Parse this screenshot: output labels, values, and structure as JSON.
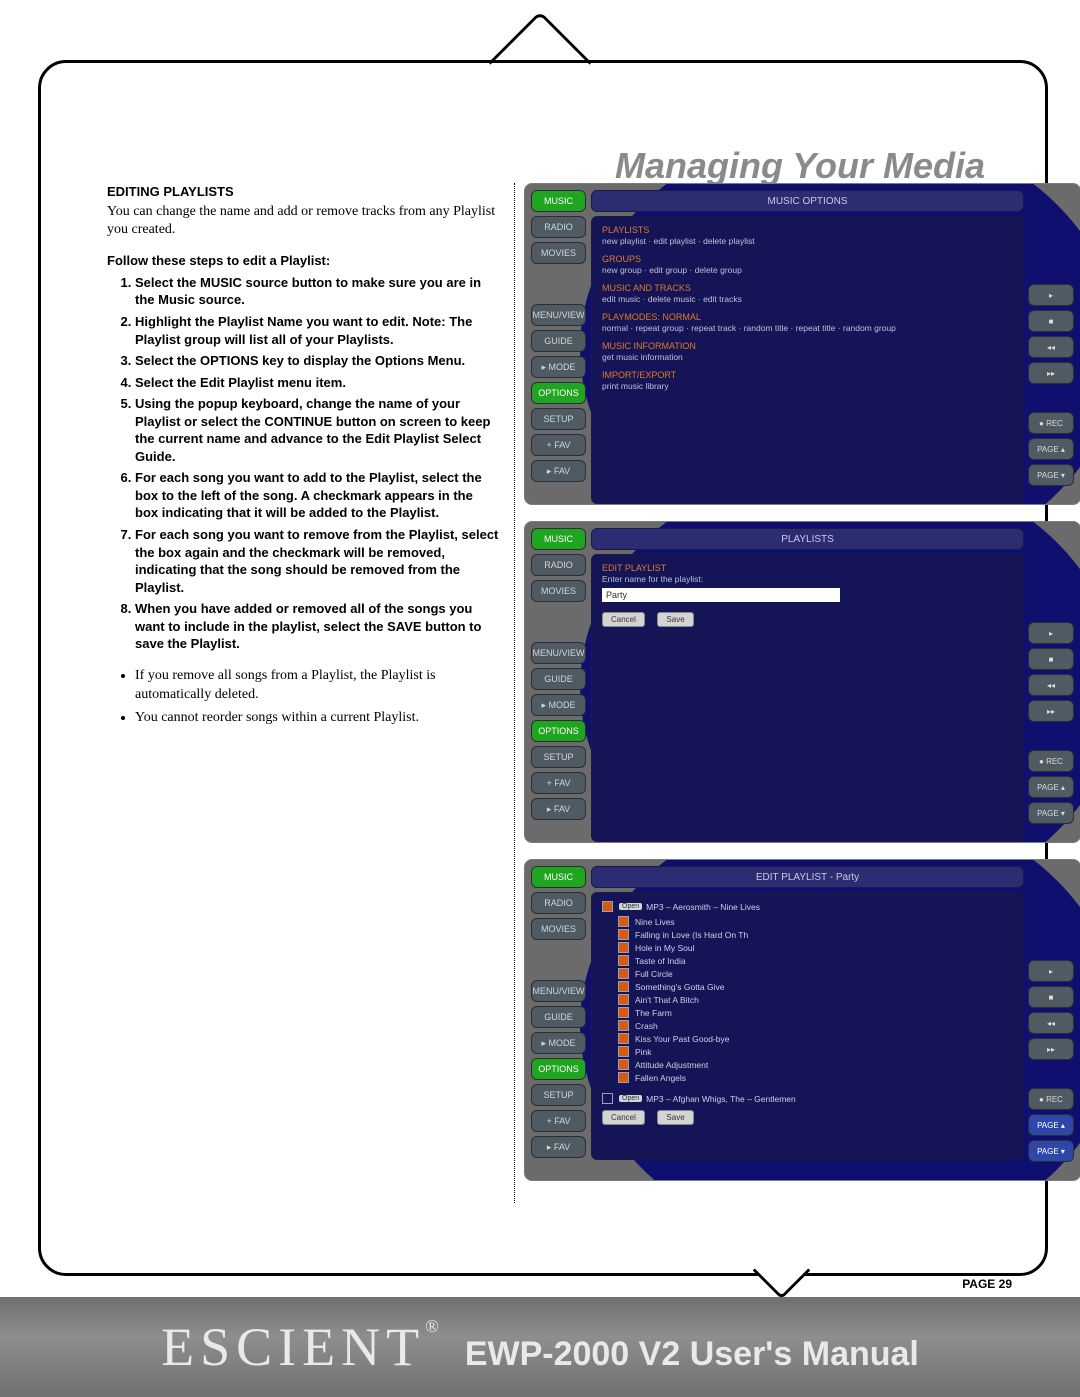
{
  "header": "Managing Your Media",
  "section_title": "EDITING PLAYLISTS",
  "intro": "You can change the name and add or remove tracks from any Playlist you created.",
  "steps_title": "Follow these steps to edit a Playlist:",
  "steps": [
    "Select the MUSIC source button to make sure you are in the Music source.",
    "Highlight the Playlist Name you want to edit. Note: The Playlist group will list all of your Playlists.",
    "Select the OPTIONS key to display the Options Menu.",
    "Select the Edit Playlist menu item.",
    "Using the popup keyboard, change the name of your Playlist or select the CONTINUE button on screen to keep the current name and advance to the Edit Playlist Select Guide.",
    "For each song you want to add to the Playlist, select the box to the left of the song. A checkmark appears in the box indicating that it will be added to the Playlist.",
    "For each song you want to remove from the Playlist, select the box again and the checkmark will be removed, indicating that the song should be removed from the Playlist.",
    "When you have added or removed all of the songs you want to include in the playlist, select the SAVE button to save the Playlist."
  ],
  "notes": [
    "If you remove all songs from a Playlist, the Playlist is automatically deleted.",
    "You cannot reorder songs within a current Playlist."
  ],
  "side_buttons": [
    "MUSIC",
    "RADIO",
    "MOVIES",
    "",
    "MENU/VIEW",
    "GUIDE",
    "▸ MODE",
    "OPTIONS",
    "SETUP",
    "+ FAV",
    "▸ FAV"
  ],
  "right_buttons": [
    "▸",
    "■",
    "◂◂",
    "▸▸",
    "● REC",
    "PAGE ▴",
    "PAGE ▾"
  ],
  "shot1": {
    "title": "MUSIC OPTIONS",
    "options": [
      {
        "head": "PLAYLISTS",
        "sub": "new playlist · edit playlist · delete playlist"
      },
      {
        "head": "GROUPS",
        "sub": "new group · edit group · delete group"
      },
      {
        "head": "MUSIC AND TRACKS",
        "sub": "edit music · delete music · edit tracks"
      },
      {
        "head": "PLAYMODES: NORMAL",
        "sub": "normal · repeat group · repeat track · random title · repeat title · random group"
      },
      {
        "head": "MUSIC INFORMATION",
        "sub": "get music information"
      },
      {
        "head": "IMPORT/EXPORT",
        "sub": "print music library"
      }
    ]
  },
  "shot2": {
    "title": "PLAYLISTS",
    "subtitle": "EDIT PLAYLIST",
    "prompt": "Enter name for the playlist:",
    "value": "Party",
    "btn_cancel": "Cancel",
    "btn_save": "Save"
  },
  "shot3": {
    "title": "EDIT PLAYLIST - Party",
    "album_open": "MP3 – Aerosmith – Nine Lives",
    "tracks": [
      {
        "t": "Nine Lives",
        "c": true
      },
      {
        "t": "Falling in Love (Is Hard On Th",
        "c": true
      },
      {
        "t": "Hole in My Soul",
        "c": true
      },
      {
        "t": "Taste of India",
        "c": true
      },
      {
        "t": "Full Circle",
        "c": true
      },
      {
        "t": "Something's Gotta Give",
        "c": true
      },
      {
        "t": "Ain't That A Bitch",
        "c": true
      },
      {
        "t": "The Farm",
        "c": true
      },
      {
        "t": "Crash",
        "c": true
      },
      {
        "t": "Kiss Your Past Good-bye",
        "c": true
      },
      {
        "t": "Pink",
        "c": true
      },
      {
        "t": "Attitude Adjustment",
        "c": true
      },
      {
        "t": "Fallen Angels",
        "c": true
      }
    ],
    "album_closed": "MP3 – Afghan Whigs, The – Gentlemen",
    "btn_cancel": "Cancel",
    "btn_save": "Save"
  },
  "page_label": "PAGE 29",
  "brand": "ESCIENT",
  "reg": "®",
  "manual": "EWP-2000 V2 User's Manual"
}
